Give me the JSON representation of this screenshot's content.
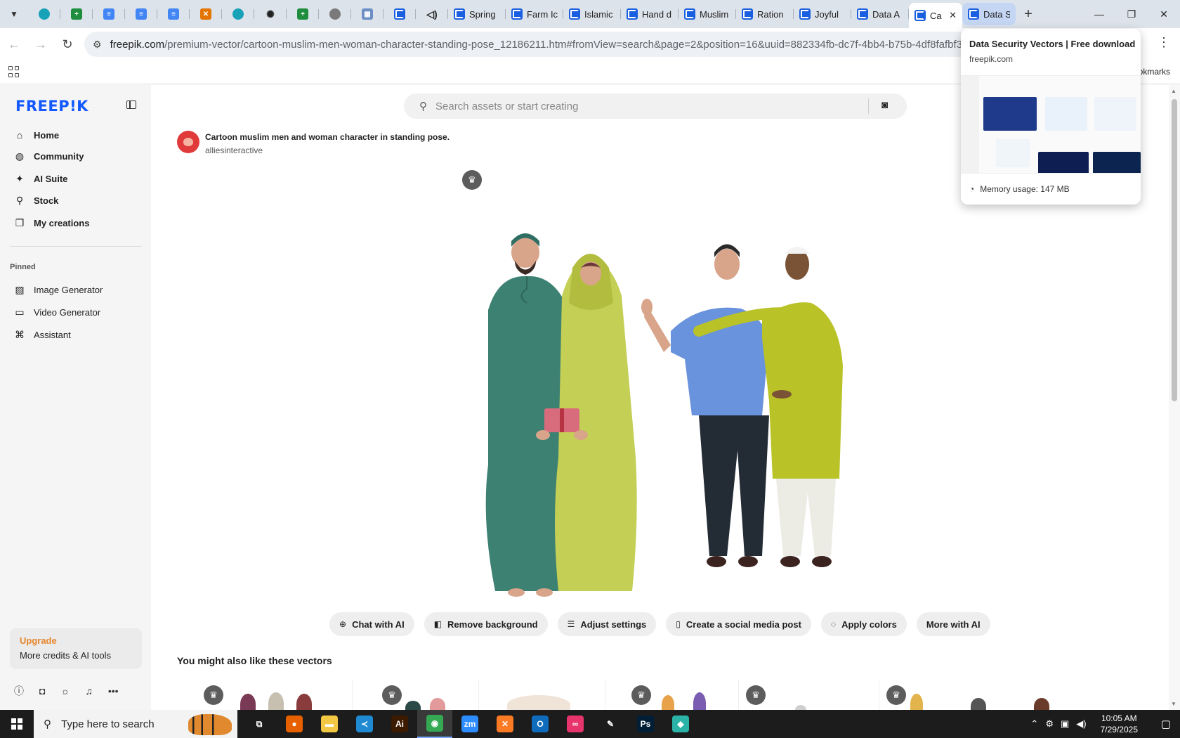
{
  "browser": {
    "tabs": [
      {
        "title": "",
        "icon": "vpn-shield-icon",
        "type": "pinned"
      },
      {
        "title": "",
        "icon": "sheets-icon",
        "type": "pinned"
      },
      {
        "title": "",
        "icon": "docs-icon",
        "type": "pinned"
      },
      {
        "title": "",
        "icon": "docs-icon",
        "type": "pinned"
      },
      {
        "title": "",
        "icon": "docs-icon",
        "type": "pinned"
      },
      {
        "title": "",
        "icon": "xampp-icon",
        "type": "pinned"
      },
      {
        "title": "",
        "icon": "teal-app-icon",
        "type": "pinned"
      },
      {
        "title": "",
        "icon": "openai-icon",
        "type": "pinned"
      },
      {
        "title": "",
        "icon": "sheets-icon",
        "type": "pinned"
      },
      {
        "title": "",
        "icon": "globe-icon",
        "type": "pinned"
      },
      {
        "title": "",
        "icon": "qr-icon",
        "type": "pinned"
      },
      {
        "title": "",
        "icon": "freepik-icon",
        "type": "pinned"
      },
      {
        "title": "",
        "icon": "speaker-icon",
        "type": "pinned"
      },
      {
        "title": "Spring",
        "icon": "freepik-icon",
        "type": "normal"
      },
      {
        "title": "Farm Ic",
        "icon": "freepik-icon",
        "type": "normal"
      },
      {
        "title": "Islamic",
        "icon": "freepik-icon",
        "type": "normal"
      },
      {
        "title": "Hand d",
        "icon": "freepik-icon",
        "type": "normal"
      },
      {
        "title": "Muslim",
        "icon": "freepik-icon",
        "type": "normal"
      },
      {
        "title": "Ration",
        "icon": "freepik-icon",
        "type": "normal"
      },
      {
        "title": "Joyful",
        "icon": "freepik-icon",
        "type": "normal"
      },
      {
        "title": "Data A",
        "icon": "freepik-icon",
        "type": "normal"
      },
      {
        "title": "Ca",
        "icon": "freepik-icon",
        "type": "active"
      },
      {
        "title": "Data S",
        "icon": "freepik-icon",
        "type": "hover"
      }
    ],
    "close_glyph": "✕",
    "new_tab_glyph": "+",
    "win_minimize": "—",
    "win_restore": "❐",
    "win_close": "✕",
    "url_host": "freepik.com",
    "url_path": "/premium-vector/cartoon-muslim-men-woman-character-standing-pose_12186211.htm#fromView=search&page=2&position=16&uuid=882334fb-dc7f-4bb4-b75b-4df8fafbf343&que",
    "bookmarks_label": "okmarks"
  },
  "hover_card": {
    "title": "Data Security Vectors | Free download",
    "domain": "freepik.com",
    "memory": "Memory usage: 147 MB"
  },
  "sidebar": {
    "logo": "FREEP!K",
    "nav": [
      {
        "label": "Home",
        "icon": "home-icon"
      },
      {
        "label": "Community",
        "icon": "globe-icon"
      },
      {
        "label": "AI Suite",
        "icon": "sparkle-icon"
      },
      {
        "label": "Stock",
        "icon": "search-icon"
      },
      {
        "label": "My creations",
        "icon": "folder-icon"
      }
    ],
    "pinned_label": "Pinned",
    "pinned": [
      {
        "label": "Image Generator",
        "icon": "image-icon"
      },
      {
        "label": "Video Generator",
        "icon": "video-icon"
      },
      {
        "label": "Assistant",
        "icon": "assistant-icon"
      }
    ],
    "upgrade_title": "Upgrade",
    "upgrade_sub": "More credits & AI tools"
  },
  "main": {
    "search_placeholder": "Search assets or start creating",
    "asset_title": "Cartoon muslim men and woman character in standing pose.",
    "asset_author": "alliesinteractive",
    "ai_tools": [
      {
        "label": "Chat with AI",
        "icon": "chat-plus-icon"
      },
      {
        "label": "Remove background",
        "icon": "remove-bg-icon"
      },
      {
        "label": "Adjust settings",
        "icon": "sliders-icon"
      },
      {
        "label": "Create a social media post",
        "icon": "phone-icon"
      },
      {
        "label": "Apply colors",
        "icon": "palette-icon"
      },
      {
        "label": "More with AI",
        "icon": ""
      }
    ],
    "related_title": "You might also like these vectors"
  },
  "taskbar": {
    "search_placeholder": "Type here to search",
    "apps": [
      {
        "name": "task-view",
        "label": "⧉",
        "color": "#1c1c1c"
      },
      {
        "name": "firefox",
        "label": "●",
        "color": "#e66000"
      },
      {
        "name": "file-explorer",
        "label": "▬",
        "color": "#f2c744"
      },
      {
        "name": "vscode",
        "label": "≺",
        "color": "#1f8ad2"
      },
      {
        "name": "illustrator",
        "label": "Ai",
        "color": "#3c1a00"
      },
      {
        "name": "chrome",
        "label": "◉",
        "color": "#34a853"
      },
      {
        "name": "zoom",
        "label": "zm",
        "color": "#2d8cff"
      },
      {
        "name": "xampp",
        "label": "✕",
        "color": "#fb7a24"
      },
      {
        "name": "outlook",
        "label": "O",
        "color": "#0f6cbd"
      },
      {
        "name": "creative-cloud",
        "label": "∞",
        "color": "#e8346d"
      },
      {
        "name": "pen-tool",
        "label": "✎",
        "color": "#1c1c1c"
      },
      {
        "name": "photoshop",
        "label": "Ps",
        "color": "#001e36"
      },
      {
        "name": "gem-app",
        "label": "◆",
        "color": "#2bb3a8"
      }
    ],
    "active_app": "chrome",
    "time": "10:05 AM",
    "date": "7/29/2025"
  },
  "colors": {
    "brand": "#1359ff",
    "upgrade": "#e7862c",
    "tabstrip": "#dde3ea"
  }
}
